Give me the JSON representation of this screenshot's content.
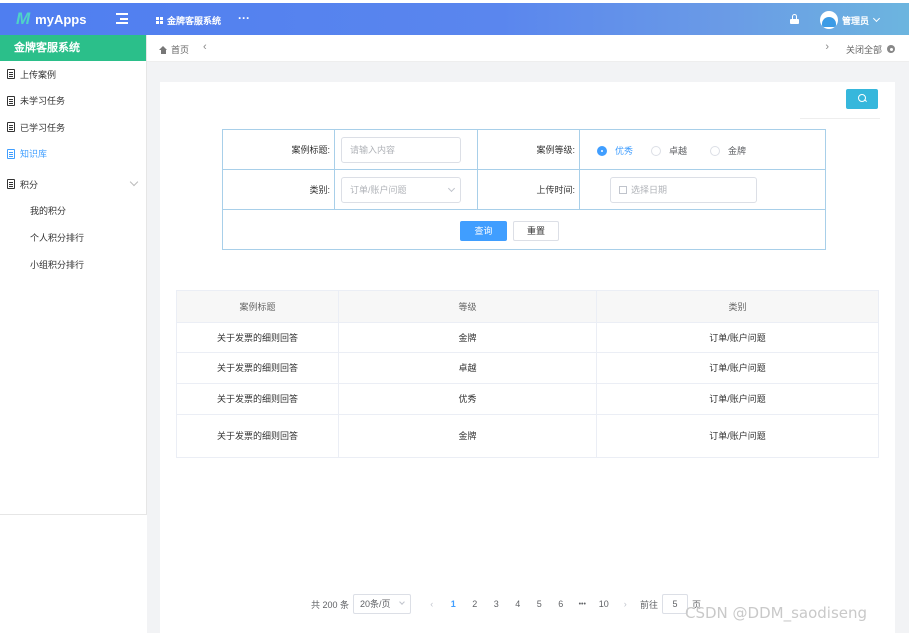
{
  "header": {
    "logo_mark": "M",
    "app_name": "myApps",
    "system_name": "金牌客服系统",
    "more": "···",
    "user_name": "管理员",
    "icons": [
      "menu-toggle-icon",
      "grid-icon",
      "lock-icon",
      "avatar",
      "chevron-down-icon"
    ]
  },
  "sidebar": {
    "title": "金牌客服系统",
    "items": [
      {
        "label": "上传案例"
      },
      {
        "label": "未学习任务"
      },
      {
        "label": "已学习任务"
      },
      {
        "label": "知识库",
        "active": true
      },
      {
        "label": "积分",
        "expanded": true
      }
    ],
    "sub_items": [
      {
        "label": "我的积分"
      },
      {
        "label": "个人积分排行"
      },
      {
        "label": "小组积分排行"
      }
    ]
  },
  "tabs": {
    "home": "首页",
    "close_all": "关闭全部"
  },
  "filter": {
    "title_label": "案例标题:",
    "title_placeholder": "请输入内容",
    "level_label": "案例等级:",
    "levels": [
      "优秀",
      "卓越",
      "金牌"
    ],
    "level_selected": "优秀",
    "category_label": "类别:",
    "category_value": "订单/账户问题",
    "upload_time_label": "上传时间:",
    "date_placeholder": "选择日期",
    "search_button": "查询",
    "reset_button": "重置"
  },
  "table": {
    "headers": [
      "案例标题",
      "等级",
      "类别"
    ],
    "rows": [
      [
        "关于发票的细则回答",
        "金牌",
        "订单/账户问题"
      ],
      [
        "关于发票的细则回答",
        "卓越",
        "订单/账户问题"
      ],
      [
        "关于发票的细则回答",
        "优秀",
        "订单/账户问题"
      ],
      [
        "关于发票的细则回答",
        "金牌",
        "订单/账户问题"
      ]
    ]
  },
  "pagination": {
    "total": "共 200 条",
    "page_size": "20条/页",
    "prev": "‹",
    "next": "›",
    "pages": [
      "1",
      "2",
      "3",
      "4",
      "5",
      "6",
      "•••",
      "10"
    ],
    "current_page": "1",
    "goto_label": "前往",
    "goto_value": "5",
    "page_unit": "页"
  },
  "watermark": "CSDN @DDM_saodiseng",
  "colors": {
    "header_start": "#4f7ef0",
    "header_end": "#6cb5df",
    "sidebar_header": "#2bbf8a",
    "primary": "#409eff",
    "search_toggle": "#36b7dc",
    "form_border": "#a8cfe9"
  }
}
